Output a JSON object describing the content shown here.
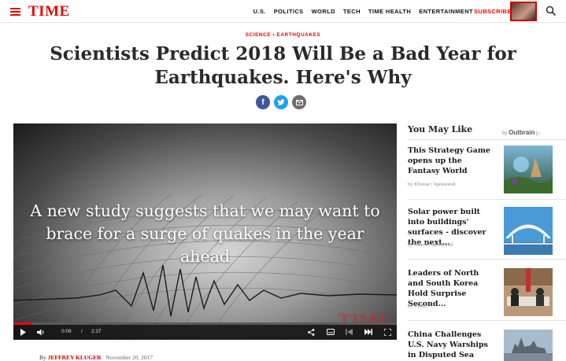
{
  "header": {
    "logo": "TIME",
    "nav": [
      "U.S.",
      "POLITICS",
      "WORLD",
      "TECH",
      "TIME HEALTH",
      "ENTERTAINMENT"
    ],
    "subscribe": "SUBSCRIBE"
  },
  "article": {
    "kicker": "SCIENCE • EARTHQUAKES",
    "headline": "Scientists Predict 2018 Will Be a Bad Year for Earthquakes. Here's Why",
    "byline_prefix": "By",
    "author": "JEFFREY KLUGER",
    "date": "November 20, 2017"
  },
  "video": {
    "caption": "A new study suggests that we may want to brace for a surge of quakes in the year ahead",
    "watermark": "TIME",
    "current_time": "0:08",
    "separator": "/",
    "duration": "2:37",
    "progress": 0.05
  },
  "sidebar": {
    "title": "You May Like",
    "by": "by",
    "brand": "Outbrain",
    "cards": [
      {
        "title": "This Strategy Game opens up the Fantasy World",
        "source": "by Elvenar | Sponsored"
      },
      {
        "title": "Solar power built into buildings' surfaces - discover the next...",
        "source": "by Merck | Sponsored"
      },
      {
        "title": "Leaders of North and South Korea Hold Surprise Second...",
        "source": "by TIME"
      },
      {
        "title": "China Challenges U.S. Navy Warships in Disputed Sea",
        "source": ""
      }
    ]
  },
  "colors": {
    "brand_red": "#e90606",
    "facebook": "#3b5998",
    "twitter": "#1da1f2",
    "email": "#6d6d6d"
  }
}
